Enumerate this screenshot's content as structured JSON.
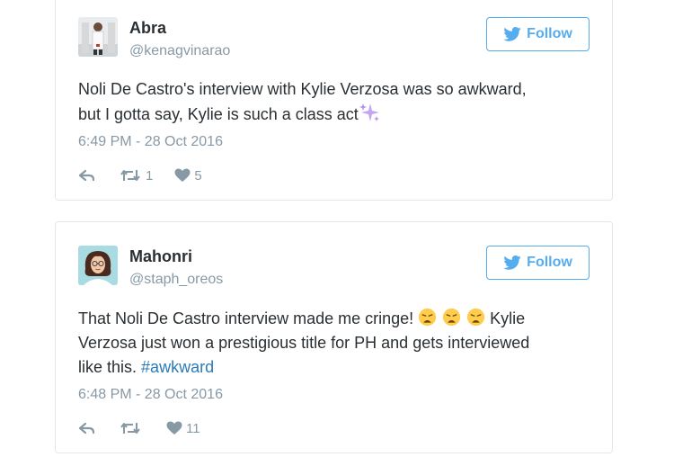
{
  "tweets": [
    {
      "display_name": "Abra",
      "handle": "@kenagvinarao",
      "follow_label": "Follow",
      "text_line1": "Noli De Castro's interview with Kylie Verzosa was so awkward,",
      "text_line2": "but I gotta say, Kylie is such a class act",
      "timestamp": "6:49 PM - 28 Oct 2016",
      "retweet_count": "1",
      "like_count": "5"
    },
    {
      "display_name": "Mahonri",
      "handle": "@staph_oreos",
      "follow_label": "Follow",
      "text_line1_a": "That Noli De Castro interview made me cringe!",
      "text_line1_b": "Kylie",
      "text_line2": "Verzosa just won a prestigious title for PH and gets interviewed",
      "text_line3": "like this.",
      "hashtag": "#awkward",
      "timestamp": "6:48 PM - 28 Oct 2016",
      "like_count": "11"
    }
  ],
  "icons": {
    "reply": "reply-icon",
    "retweet": "retweet-icon",
    "like": "heart-icon",
    "twitter": "twitter-bird-icon",
    "sparkles": "sparkles-emoji",
    "weary": "weary-face-emoji"
  },
  "colors": {
    "accent": "#55acee",
    "hashtag": "#2b7bb9",
    "muted": "#8899a6",
    "text": "#292f33",
    "border": "#e1e8ed"
  }
}
